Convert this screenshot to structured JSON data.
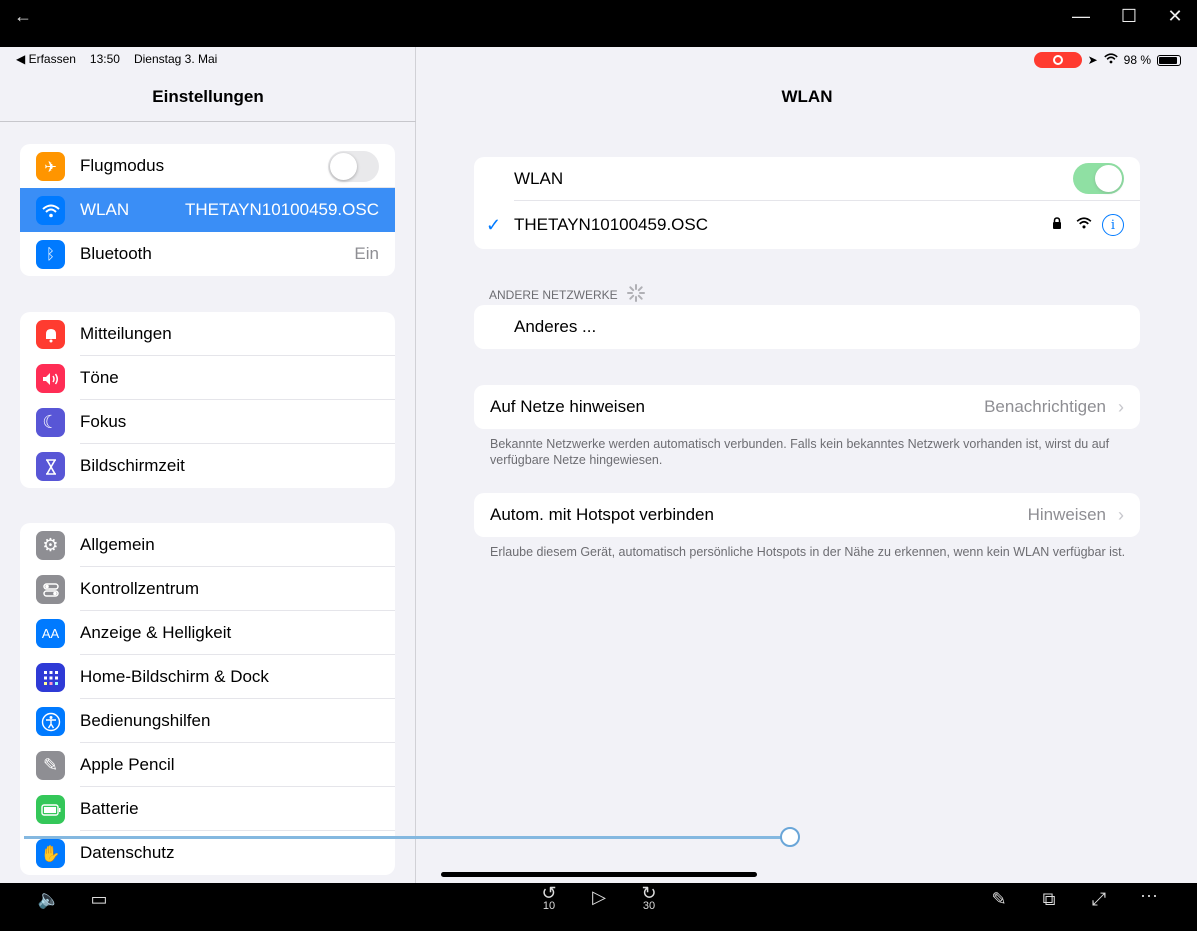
{
  "window": {
    "back_icon": "arrow-left-icon",
    "minimize": "—",
    "maximize": "☐",
    "close": "✕"
  },
  "status": {
    "back_app": "◀ Erfassen",
    "time": "13:50",
    "date": "Dienstag 3. Mai",
    "battery": "98 %"
  },
  "sidebar": {
    "title": "Einstellungen",
    "group1": [
      {
        "label": "Flugmodus",
        "icon": "airplane-icon",
        "glyph": "✈",
        "color": "#ff9500",
        "toggle": false
      },
      {
        "label": "WLAN",
        "icon": "wifi-icon",
        "glyph": "≋",
        "color": "#007aff",
        "value": "THETAYN10100459.OSC",
        "selected": true
      },
      {
        "label": "Bluetooth",
        "icon": "bluetooth-icon",
        "glyph": "ᛒ",
        "color": "#007aff",
        "value": "Ein"
      }
    ],
    "group2": [
      {
        "label": "Mitteilungen",
        "icon": "bell-icon",
        "glyph": "🔔",
        "color": "#ff3b30"
      },
      {
        "label": "Töne",
        "icon": "speaker-icon",
        "glyph": "🔊",
        "color": "#ff2d55"
      },
      {
        "label": "Fokus",
        "icon": "moon-icon",
        "glyph": "☾",
        "color": "#5856d6"
      },
      {
        "label": "Bildschirmzeit",
        "icon": "hourglass-icon",
        "glyph": "⧗",
        "color": "#5856d6"
      }
    ],
    "group3": [
      {
        "label": "Allgemein",
        "icon": "gear-icon",
        "glyph": "⚙",
        "color": "#8e8e93"
      },
      {
        "label": "Kontrollzentrum",
        "icon": "switches-icon",
        "glyph": "⊜",
        "color": "#8e8e93"
      },
      {
        "label": "Anzeige & Helligkeit",
        "icon": "text-size-icon",
        "glyph": "AA",
        "color": "#007aff"
      },
      {
        "label": "Home-Bildschirm & Dock",
        "icon": "grid-icon",
        "glyph": "▦",
        "color": "#3a3aff"
      },
      {
        "label": "Bedienungshilfen",
        "icon": "accessibility-icon",
        "glyph": "♿",
        "color": "#007aff"
      },
      {
        "label": "Apple Pencil",
        "icon": "pencil-icon",
        "glyph": "✎",
        "color": "#8e8e93"
      },
      {
        "label": "Batterie",
        "icon": "battery-icon",
        "glyph": "▭",
        "color": "#34c759"
      },
      {
        "label": "Datenschutz",
        "icon": "hand-icon",
        "glyph": "✋",
        "color": "#007aff"
      }
    ]
  },
  "main": {
    "title": "WLAN",
    "wlan_label": "WLAN",
    "wlan_on": true,
    "network": "THETAYN10100459.OSC",
    "others_header": "ANDERE NETZWERKE",
    "other_label": "Anderes ...",
    "ask_label": "Auf Netze hinweisen",
    "ask_value": "Benachrichtigen",
    "ask_note": "Bekannte Netzwerke werden automatisch verbunden. Falls kein bekanntes Netzwerk vorhanden ist, wirst du auf verfügbare Netze hingewiesen.",
    "hotspot_label": "Autom. mit Hotspot verbinden",
    "hotspot_value": "Hinweisen",
    "hotspot_note": "Erlaube diesem Gerät, automatisch persönliche Hotspots in der Nähe zu erkennen, wenn kein WLAN verfügbar ist."
  },
  "player": {
    "rewind": "10",
    "forward": "30"
  }
}
